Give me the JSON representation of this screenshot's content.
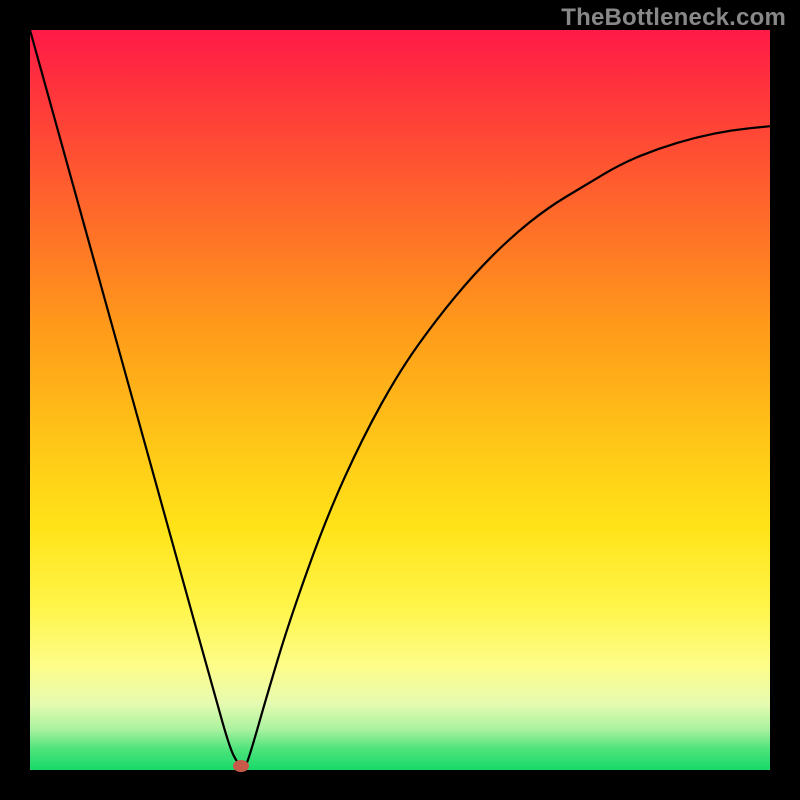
{
  "watermark": "TheBottleneck.com",
  "chart_data": {
    "type": "line",
    "title": "",
    "xlabel": "",
    "ylabel": "",
    "xlim": [
      0,
      100
    ],
    "ylim": [
      0,
      100
    ],
    "grid": false,
    "series": [
      {
        "name": "curve",
        "x": [
          0,
          5,
          10,
          15,
          20,
          25,
          27,
          28,
          29,
          30,
          32,
          35,
          40,
          45,
          50,
          55,
          60,
          65,
          70,
          75,
          80,
          85,
          90,
          95,
          100
        ],
        "y": [
          100,
          82,
          64,
          46,
          28,
          10,
          3,
          1,
          0,
          3,
          10,
          20,
          34,
          45,
          54,
          61,
          67,
          72,
          76,
          79,
          82,
          84,
          85.5,
          86.5,
          87
        ]
      }
    ],
    "marker": {
      "x": 28.5,
      "y": 0.5
    },
    "background_gradient_stops": [
      {
        "pct": 0,
        "color": "#ff1a47"
      },
      {
        "pct": 10,
        "color": "#ff3a3a"
      },
      {
        "pct": 25,
        "color": "#ff6a2a"
      },
      {
        "pct": 40,
        "color": "#ff9a1a"
      },
      {
        "pct": 55,
        "color": "#ffc418"
      },
      {
        "pct": 67,
        "color": "#ffe318"
      },
      {
        "pct": 78,
        "color": "#fff54a"
      },
      {
        "pct": 86,
        "color": "#fdfd8a"
      },
      {
        "pct": 91,
        "color": "#e6fbb0"
      },
      {
        "pct": 94.5,
        "color": "#aaf2a0"
      },
      {
        "pct": 97.2,
        "color": "#4de37a"
      },
      {
        "pct": 100,
        "color": "#18d96a"
      }
    ]
  }
}
